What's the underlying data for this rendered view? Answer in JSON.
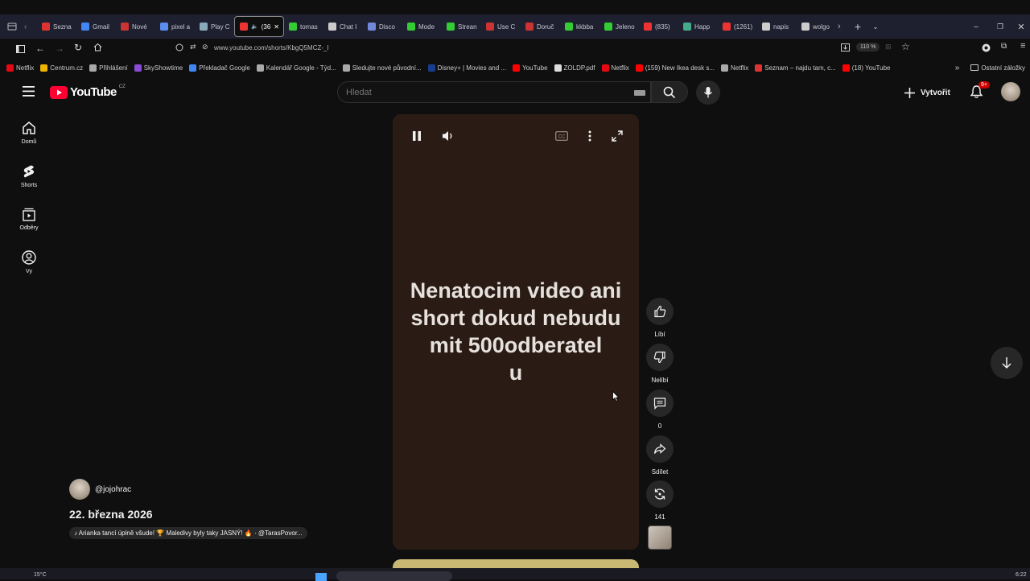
{
  "browser": {
    "tabs": [
      {
        "label": "Sezna",
        "color": "#d33"
      },
      {
        "label": "Gmail",
        "color": "#4285f4"
      },
      {
        "label": "Nové",
        "color": "#c33"
      },
      {
        "label": "pixel a",
        "color": "#5b8def"
      },
      {
        "label": "Play C",
        "color": "#8ab"
      },
      {
        "label": "(36",
        "color": "#e33",
        "active": true
      },
      {
        "label": "tomas",
        "color": "#3c3"
      },
      {
        "label": "Chat I",
        "color": "#ccc"
      },
      {
        "label": "Disco",
        "color": "#7289da"
      },
      {
        "label": "Mode",
        "color": "#3c3"
      },
      {
        "label": "Strean",
        "color": "#3c3"
      },
      {
        "label": "Use C",
        "color": "#c33"
      },
      {
        "label": "Doruč",
        "color": "#c33"
      },
      {
        "label": "kkbba",
        "color": "#3c3"
      },
      {
        "label": "Jeleno",
        "color": "#3c3"
      },
      {
        "label": "(835)",
        "color": "#e33"
      },
      {
        "label": "Happ",
        "color": "#4a8"
      },
      {
        "label": "(1261)",
        "color": "#e33"
      },
      {
        "label": "napis",
        "color": "#ccc"
      },
      {
        "label": "wolgo",
        "color": "#ccc"
      }
    ],
    "url": "www.youtube.com/shorts/KbgQ5MCZ-_I",
    "zoom": "110 %",
    "bookmarks": [
      {
        "label": "Netflix",
        "color": "#e50914"
      },
      {
        "label": "Centrum.cz",
        "color": "#f0b400"
      },
      {
        "label": "Přihlášení",
        "color": "#aaa"
      },
      {
        "label": "SkyShowtime",
        "color": "#8a4bd6"
      },
      {
        "label": "Překladač Google",
        "color": "#4285f4"
      },
      {
        "label": "Kalendář Google - Týd...",
        "color": "#aaa"
      },
      {
        "label": "Sledujte nové původní...",
        "color": "#aaa"
      },
      {
        "label": "Disney+ | Movies and ...",
        "color": "#1a3c8f"
      },
      {
        "label": "YouTube",
        "color": "#f00"
      },
      {
        "label": "ZOLDP.pdf",
        "color": "#ddd"
      },
      {
        "label": "Netflix",
        "color": "#e50914"
      },
      {
        "label": "(159) New Ikea desk s...",
        "color": "#f00"
      },
      {
        "label": "Netflix",
        "color": "#aaa"
      },
      {
        "label": "Seznam – najdu tam, c...",
        "color": "#d33"
      },
      {
        "label": "(18) YouTube",
        "color": "#f00"
      }
    ],
    "other_bookmarks": "Ostatní záložky"
  },
  "youtube": {
    "logo_text": "YouTube",
    "region": "CZ",
    "search_placeholder": "Hledat",
    "create_label": "Vytvořit",
    "notif_count": "9+",
    "sidebar": [
      {
        "label": "Domů",
        "icon": "home-icon"
      },
      {
        "label": "Shorts",
        "icon": "shorts-icon"
      },
      {
        "label": "Odběry",
        "icon": "subscriptions-icon"
      },
      {
        "label": "Vy",
        "icon": "you-icon"
      }
    ],
    "short": {
      "text": "Nenatocim video ani short dokud nebudu mit 500odberatel u",
      "lines": [
        "Nenatocim video ani",
        "short dokud nebudu",
        "mit 500odberatel",
        "u"
      ],
      "channel": "@jojohrac",
      "date": "22. března 2026",
      "music": "♪ Arianka tancí úplně všude! 🏆 Maledivy byly taky JASNÝ! 🔥 · @TarasPovor..."
    },
    "actions": {
      "like": "Líbí",
      "dislike": "Nelíbí",
      "comments": "0",
      "share": "Sdílet",
      "remix": "141"
    }
  },
  "colors": {
    "accent": "#ff0033",
    "video_bg": "#2a1c14",
    "page_bg": "#0f0f0f"
  },
  "taskbar": {
    "temperature": "15°C",
    "time": "6:22"
  }
}
